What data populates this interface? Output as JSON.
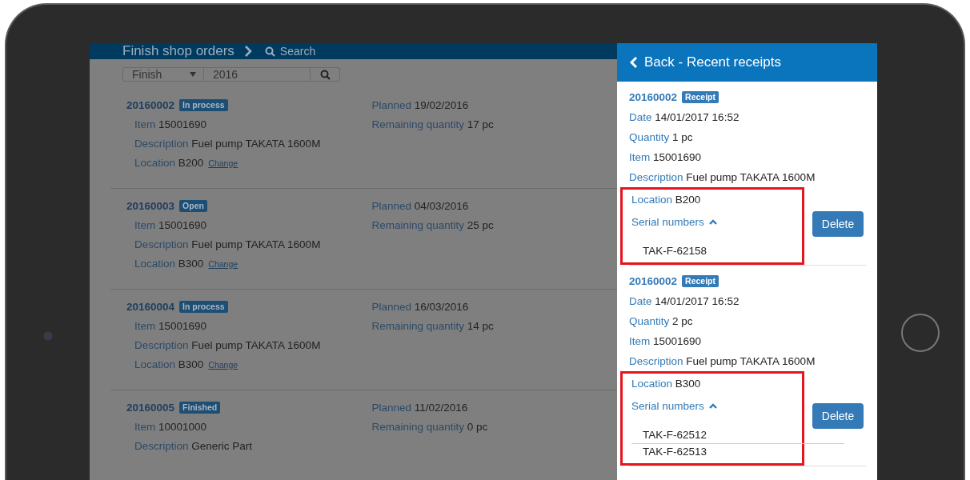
{
  "main": {
    "breadcrumb": {
      "title": "Finish shop orders",
      "search": "Search"
    },
    "filter": {
      "type": "Finish",
      "query": "2016"
    },
    "orders": [
      {
        "number": "20160002",
        "status": "In process",
        "fields": [
          {
            "label": "Item",
            "value": "15001690"
          },
          {
            "label": "Description",
            "value": "Fuel pump TAKATA 1600M"
          },
          {
            "label": "Location",
            "value": "B200",
            "link": "Change"
          }
        ],
        "side": [
          {
            "label": "Planned",
            "value": "19/02/2016"
          },
          {
            "label": "Remaining quantity",
            "value": "17 pc"
          }
        ]
      },
      {
        "number": "20160003",
        "status": "Open",
        "fields": [
          {
            "label": "Item",
            "value": "15001690"
          },
          {
            "label": "Description",
            "value": "Fuel pump TAKATA 1600M"
          },
          {
            "label": "Location",
            "value": "B300",
            "link": "Change"
          }
        ],
        "side": [
          {
            "label": "Planned",
            "value": "04/03/2016"
          },
          {
            "label": "Remaining quantity",
            "value": "25 pc"
          }
        ]
      },
      {
        "number": "20160004",
        "status": "In process",
        "fields": [
          {
            "label": "Item",
            "value": "15001690"
          },
          {
            "label": "Description",
            "value": "Fuel pump TAKATA 1600M"
          },
          {
            "label": "Location",
            "value": "B300",
            "link": "Change"
          }
        ],
        "side": [
          {
            "label": "Planned",
            "value": "16/03/2016"
          },
          {
            "label": "Remaining quantity",
            "value": "14 pc"
          }
        ]
      },
      {
        "number": "20160005",
        "status": "Finished",
        "fields": [
          {
            "label": "Item",
            "value": "10001000"
          },
          {
            "label": "Description",
            "value": "Generic Part"
          }
        ],
        "side": [
          {
            "label": "Planned",
            "value": "11/02/2016"
          },
          {
            "label": "Remaining quantity",
            "value": "0 pc"
          }
        ]
      }
    ]
  },
  "panel": {
    "title": "Back - Recent receipts",
    "receipts": [
      {
        "number": "20160002",
        "badge": "Receipt",
        "fields": [
          {
            "label": "Date",
            "value": "14/01/2017 16:52"
          },
          {
            "label": "Quantity",
            "value": "1 pc"
          },
          {
            "label": "Item",
            "value": "15001690"
          },
          {
            "label": "Description",
            "value": "Fuel pump TAKATA 1600M"
          }
        ],
        "location": {
          "label": "Location",
          "value": "B200"
        },
        "serials_label": "Serial numbers",
        "expanded": true,
        "serials": [
          "TAK-F-62158"
        ],
        "highlighted": true,
        "action": "Delete"
      },
      {
        "number": "20160002",
        "badge": "Receipt",
        "fields": [
          {
            "label": "Date",
            "value": "14/01/2017 16:52"
          },
          {
            "label": "Quantity",
            "value": "2 pc"
          },
          {
            "label": "Item",
            "value": "15001690"
          },
          {
            "label": "Description",
            "value": "Fuel pump TAKATA 1600M"
          }
        ],
        "location": {
          "label": "Location",
          "value": "B300"
        },
        "serials_label": "Serial numbers",
        "expanded": true,
        "serials": [
          "TAK-F-62512",
          "TAK-F-62513"
        ],
        "highlighted": true,
        "action": "Delete"
      }
    ]
  }
}
